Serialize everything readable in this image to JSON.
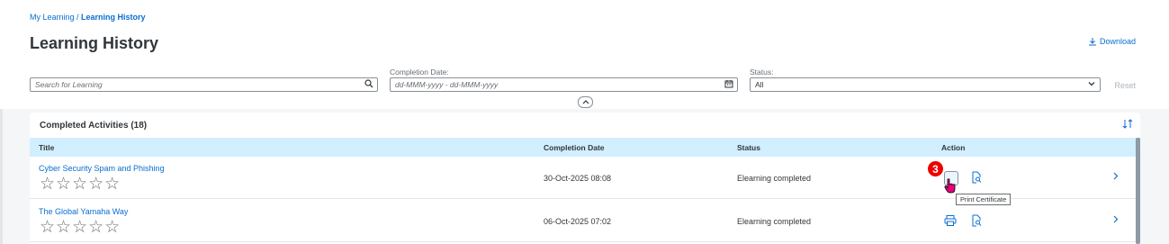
{
  "breadcrumb": {
    "parent": "My Learning",
    "separator": " / ",
    "current": "Learning History"
  },
  "page": {
    "title": "Learning History",
    "download_label": "Download"
  },
  "filters": {
    "search_placeholder": "Search for Learning",
    "completion_label": "Completion Date:",
    "completion_placeholder": "dd-MMM-yyyy - dd-MMM-yyyy",
    "status_label": "Status:",
    "status_value": "All",
    "reset_label": "Reset"
  },
  "panel": {
    "title": "Completed Activities (18)",
    "columns": [
      "Title",
      "Completion Date",
      "Status",
      "Action"
    ]
  },
  "rows": [
    {
      "title": "Cyber Security Spam and Phishing",
      "rating": "☆☆☆☆☆",
      "date": "30-Oct-2025 08:08",
      "status": "Elearning completed"
    },
    {
      "title": "The Global Yamaha Way",
      "rating": "☆☆☆☆☆",
      "date": "06-Oct-2025 07:02",
      "status": "Elearning completed"
    }
  ],
  "annotation": {
    "badge": "3",
    "tooltip": "Print Certificate"
  },
  "colors": {
    "accent": "#0a6ed1",
    "header_bg": "#d1efff",
    "badge": "#ee0000"
  }
}
